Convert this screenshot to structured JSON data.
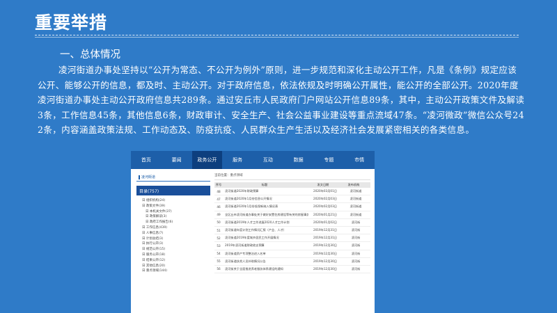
{
  "slide": {
    "title": "重要举措",
    "heading": "一、总体情况",
    "paragraph": "凌河街道办事处坚持以“公开为常态、不公开为例外”原则，进一步规范和深化主动公开工作，凡是《条例》规定应该公开、能够公开的信息，都及时、主动公开。对于政府信息，依法依规及时明确公开属性，能公开的全部公开。2020年度凌河街道办事处主动公开政府信息共289条。通过安丘市人民政府门户网站公开信息89条，其中，主动公开政策文件及解读3条，工作信息45条，其他信息6条，财政审计、安全生产、社会公益事业建设等重点流域47条。“凌河微政”微信公众号242条，内容涵盖政策法规、工作动态及、防疫抗疫、人民群众生产生活以及经济社会发展紧密相关的各类信息。"
  },
  "screenshot": {
    "nav": [
      "首页",
      "要闻",
      "政务公开",
      "服务",
      "互动",
      "数据",
      "专题",
      "市情"
    ],
    "nav_active_index": 2,
    "sidebar_title": "凌河街道",
    "sidebar_all": "目录(757)",
    "tree": [
      {
        "label": "日 组织机构(24)",
        "child": false
      },
      {
        "label": "日 政策文件(39)",
        "child": false
      },
      {
        "label": "日 本机关文件(37)",
        "child": true
      },
      {
        "label": "日 政策解读(3)",
        "child": true
      },
      {
        "label": "日 政府工作报告(6)",
        "child": true
      },
      {
        "label": "日 工作信息(439)",
        "child": false
      },
      {
        "label": "日 人事信息(7)",
        "child": false
      },
      {
        "label": "日 计划总结(3)",
        "child": false
      },
      {
        "label": "日 执行公开(3)",
        "child": false
      },
      {
        "label": "日 规范公开(15)",
        "child": false
      },
      {
        "label": "日 服务公开(18)",
        "child": false
      },
      {
        "label": "日 结果公开(12)",
        "child": false
      },
      {
        "label": "日 其他信息(20)",
        "child": false
      },
      {
        "label": "日 重点领域(144)",
        "child": false
      }
    ],
    "breadcrumb": "当前位置：重点领域",
    "table_headers": [
      "序号",
      "标题",
      "发文日期",
      "发布机构"
    ],
    "rows": [
      {
        "no": "48",
        "title": "凌河街道2020年财政预算",
        "date": "2020年03月01日",
        "org": "凌河街道"
      },
      {
        "no": "47",
        "title": "凌河街道2020年1月份信息公开情况",
        "date": "2020年02月03日",
        "org": "凌河街道"
      },
      {
        "no": "46",
        "title": "凌河街道2020年1月份低保新纳入情况表",
        "date": "2020年02月03日",
        "org": "凌河街道"
      },
      {
        "no": "49",
        "title": "全区丘市凌河街道办事处关于做好安置住房建设等有关的房屋事务的实施意见",
        "date": "2020年01月21日",
        "org": "凌河街道"
      },
      {
        "no": "50",
        "title": "凌河街道2019年人才工作进展2020人才工作计划",
        "date": "2020年01月02日",
        "org": "凌河街"
      },
      {
        "no": "51",
        "title": "凌河街道年度计划工作情况汇报（产业、人才）",
        "date": "2019年12月31日",
        "org": "凌河街"
      },
      {
        "no": "52",
        "title": "凌河街道2019年度城乡居民工作开展情况",
        "date": "2019年12月31日",
        "org": "凌河街"
      },
      {
        "no": "53",
        "title": "2019年凌河街道财政收支预算",
        "date": "2019年12月30日",
        "org": "凌河街"
      },
      {
        "no": "54",
        "title": "凌河街道资产专项整治进入名单",
        "date": "2019年12月30日",
        "org": "凌河街"
      },
      {
        "no": "55",
        "title": "凌河街道扶贫人员补助情况公告",
        "date": "2019年12月30日",
        "org": "凌河街"
      },
      {
        "no": "56",
        "title": "凌河街关于全面推进养老服务体系建设的通知",
        "date": "2019年12月30日",
        "org": "凌河街"
      }
    ]
  }
}
